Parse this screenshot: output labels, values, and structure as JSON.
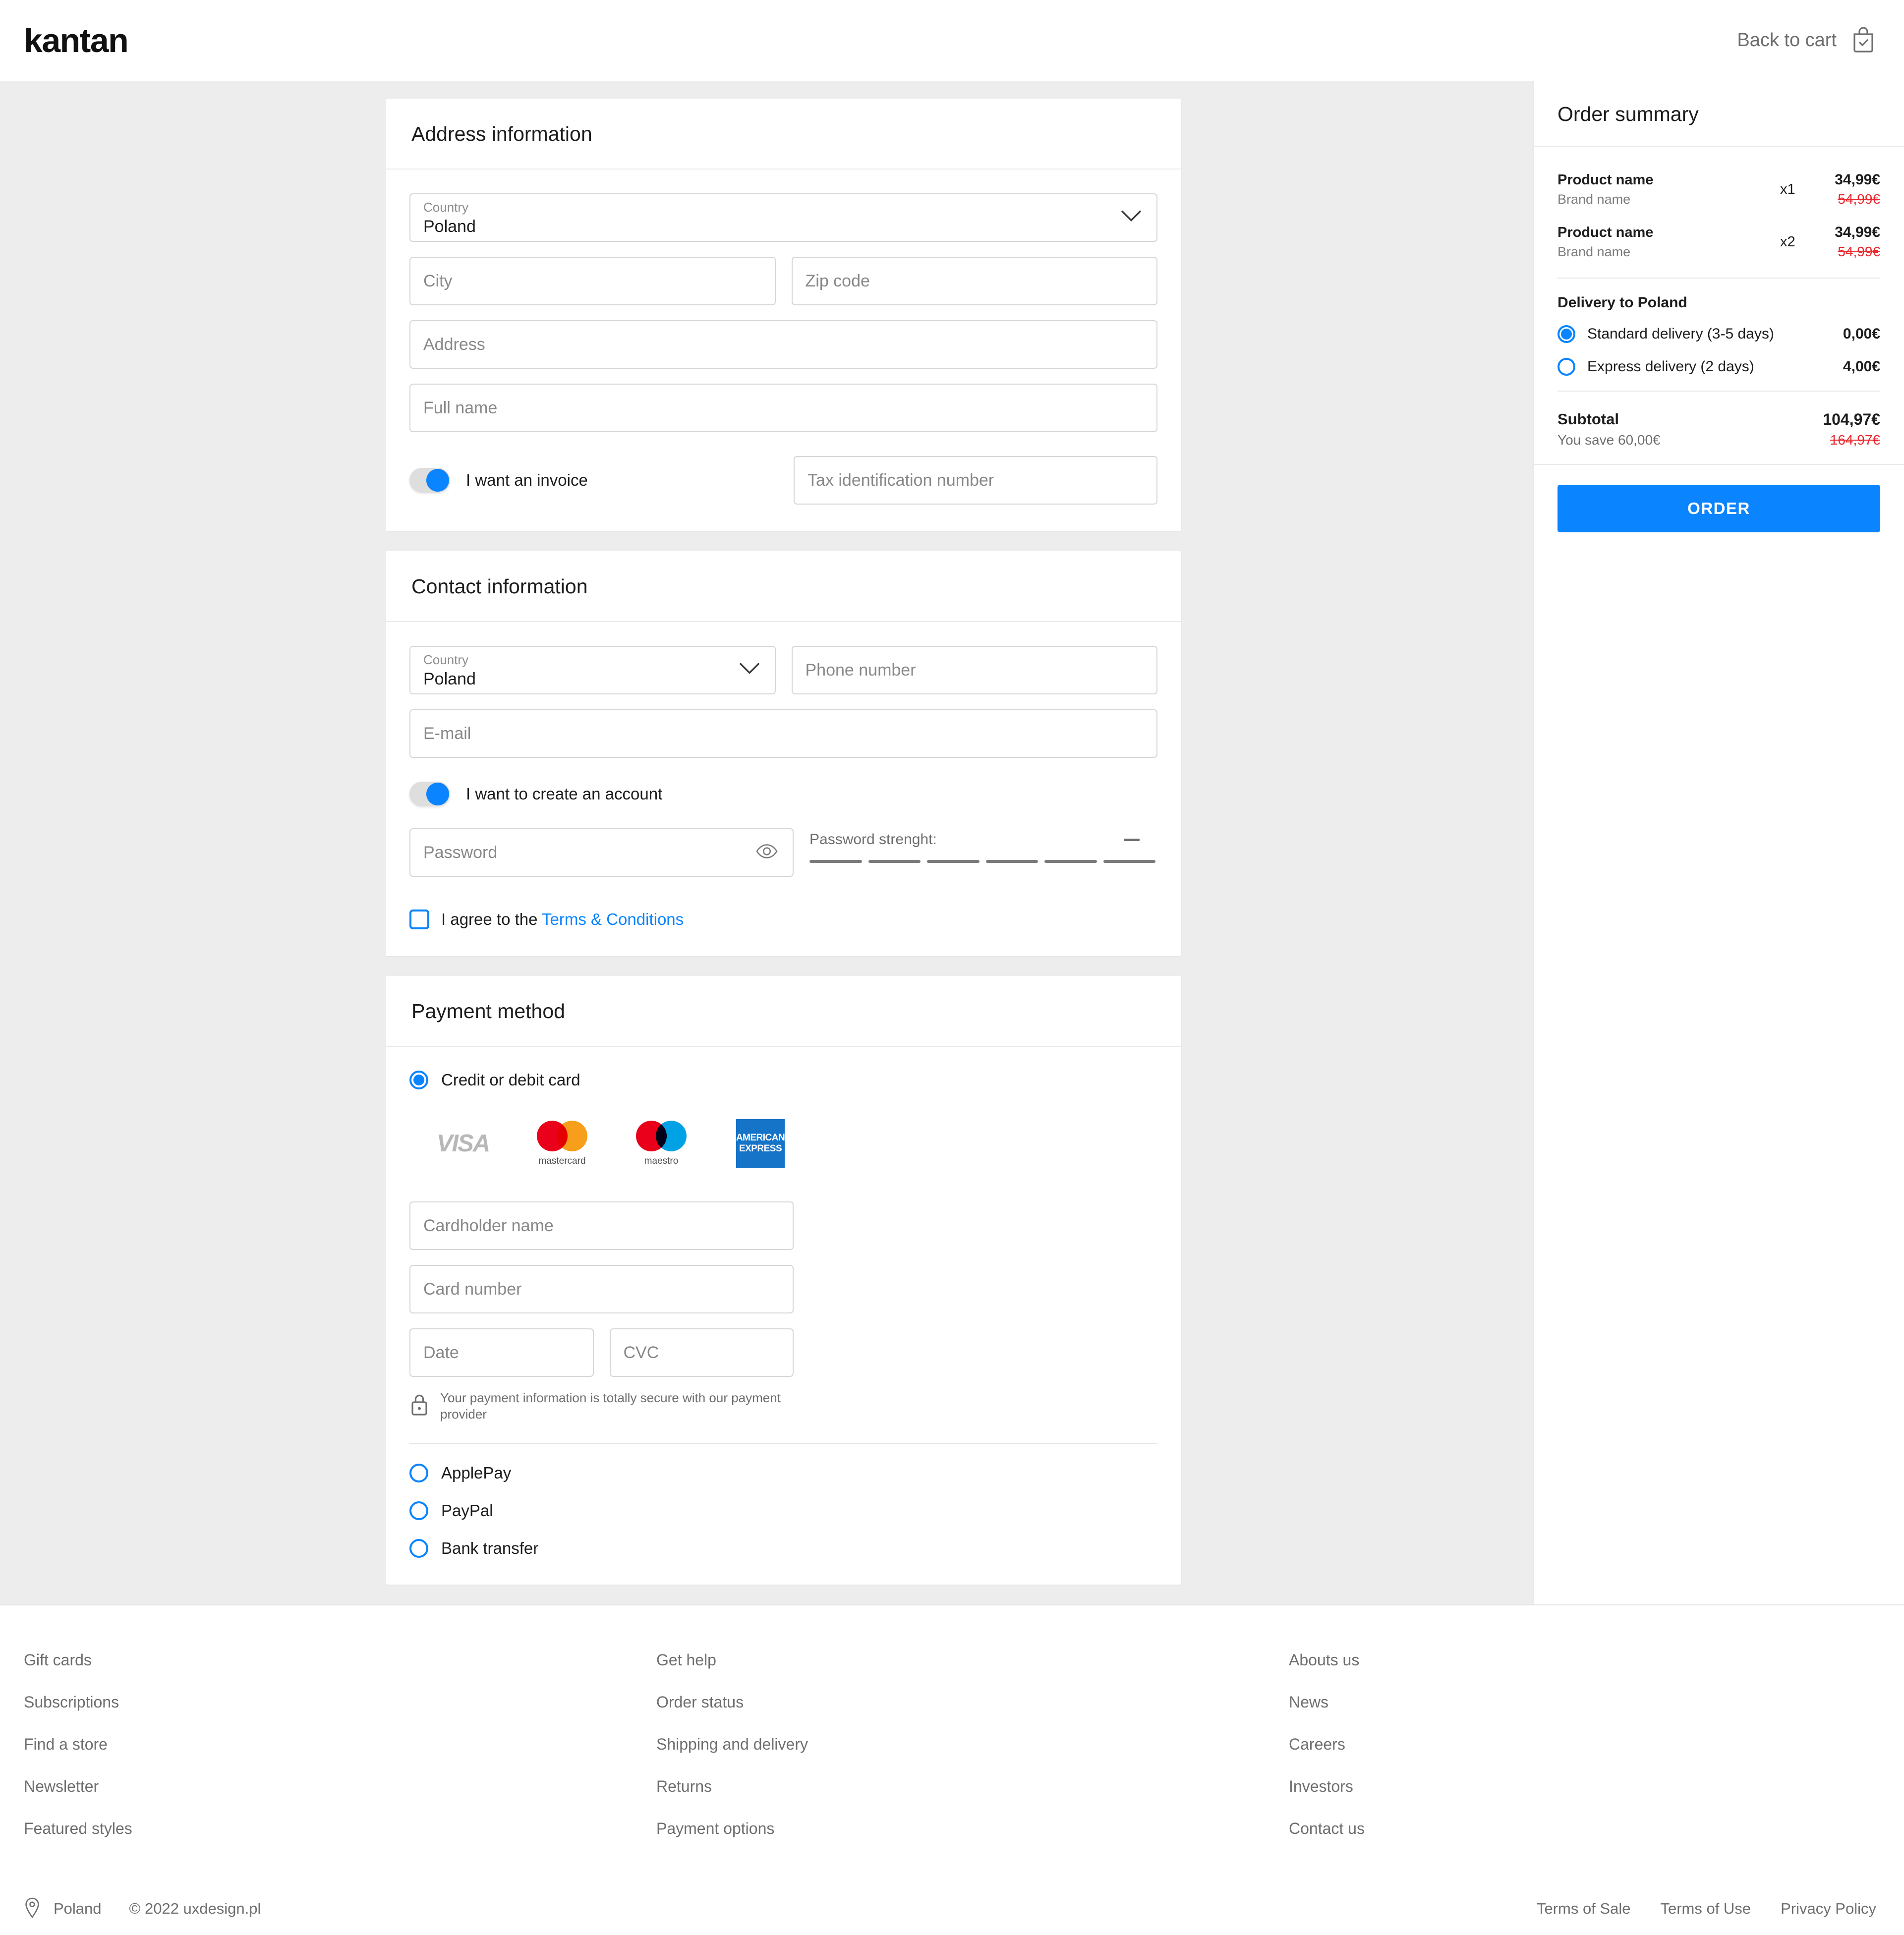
{
  "header": {
    "logo": "kantan",
    "back_to_cart": "Back to cart",
    "bag_icon": "shopping-bag-check-icon"
  },
  "address_section": {
    "title": "Address information",
    "country": {
      "label": "Country",
      "value": "Poland"
    },
    "city_placeholder": "City",
    "zip_placeholder": "Zip code",
    "address_placeholder": "Address",
    "fullname_placeholder": "Full name",
    "invoice_toggle_label": "I want an invoice",
    "invoice_toggle_on": true,
    "tax_placeholder": "Tax identification number"
  },
  "contact_section": {
    "title": "Contact information",
    "country": {
      "label": "Country",
      "value": "Poland"
    },
    "phone_placeholder": "Phone number",
    "email_placeholder": "E-mail",
    "account_toggle_label": "I want to create an account",
    "account_toggle_on": true,
    "password_placeholder": "Password",
    "password_strength_label": "Password strenght:",
    "password_strength_value": "—",
    "password_strength_segments": 6,
    "terms_prefix": "I agree to the ",
    "terms_link": "Terms & Conditions",
    "terms_checked": false
  },
  "payment_section": {
    "title": "Payment method",
    "card_option_label": "Credit or debit card",
    "card_option_selected": true,
    "brands": [
      {
        "name": "VISA",
        "caption": ""
      },
      {
        "name": "mastercard",
        "caption": "mastercard"
      },
      {
        "name": "maestro",
        "caption": "maestro"
      },
      {
        "name": "AMERICAN EXPRESS",
        "line1": "AMERICAN",
        "line2": "EXPRESS"
      }
    ],
    "cardholder_placeholder": "Cardholder name",
    "cardnumber_placeholder": "Card number",
    "date_placeholder": "Date",
    "cvc_placeholder": "CVC",
    "secure_note": "Your payment information is totally secure with our payment provider",
    "alt_options": [
      {
        "label": "ApplePay",
        "selected": false
      },
      {
        "label": "PayPal",
        "selected": false
      },
      {
        "label": "Bank transfer",
        "selected": false
      }
    ]
  },
  "summary": {
    "title": "Order summary",
    "items": [
      {
        "name": "Product name",
        "brand": "Brand name",
        "qty": "x1",
        "price": "34,99€",
        "old_price": "54,99€"
      },
      {
        "name": "Product name",
        "brand": "Brand name",
        "qty": "x2",
        "price": "34,99€",
        "old_price": "54,99€"
      }
    ],
    "delivery_title": "Delivery to Poland",
    "delivery_options": [
      {
        "label": "Standard delivery (3-5 days)",
        "price": "0,00€",
        "selected": true
      },
      {
        "label": "Express  delivery (2 days)",
        "price": "4,00€",
        "selected": false
      }
    ],
    "subtotal_label": "Subtotal",
    "subtotal_value": "104,97€",
    "save_text": "You save 60,00€",
    "subtotal_old": "164,97€",
    "order_button": "ORDER"
  },
  "footer": {
    "col1": [
      "Gift cards",
      "Subscriptions",
      "Find a store",
      "Newsletter",
      "Featured styles"
    ],
    "col2": [
      "Get help",
      "Order status",
      "Shipping and delivery",
      "Returns",
      "Payment options"
    ],
    "col3": [
      "Abouts us",
      "News",
      "Careers",
      "Investors",
      "Contact us"
    ],
    "location": "Poland",
    "copyright": "© 2022 uxdesign.pl",
    "legal": [
      "Terms of Sale",
      "Terms of Use",
      "Privacy Policy"
    ]
  },
  "colors": {
    "accent": "#0a84ff",
    "discount_red": "#e8262c",
    "page_bg": "#ededed"
  }
}
